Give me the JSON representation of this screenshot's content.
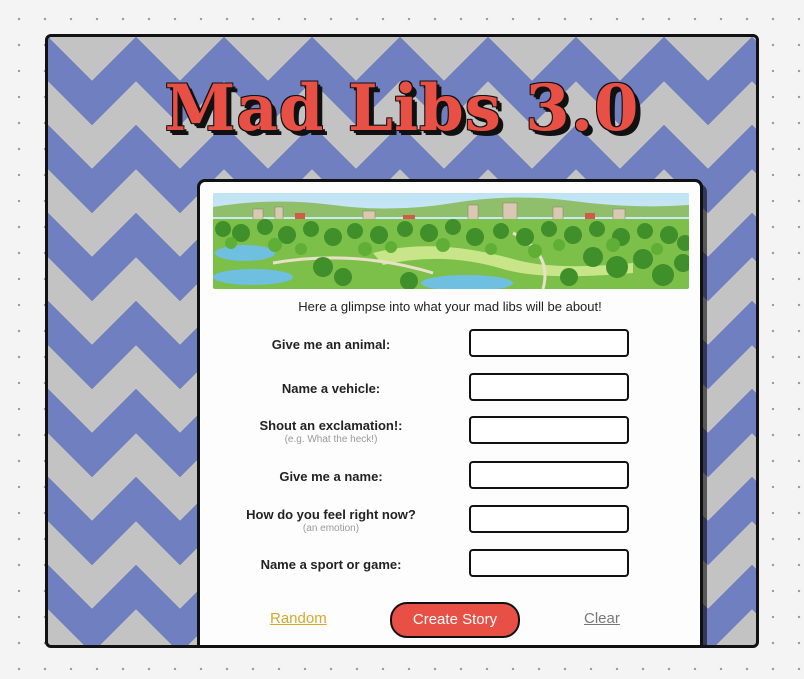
{
  "page": {
    "title": "Mad Libs 3.0",
    "glimpse_text": "Here a glimpse into what your mad libs will be about!"
  },
  "fields": [
    {
      "label": "Give me an animal:",
      "hint": "",
      "value": ""
    },
    {
      "label": "Name a vehicle:",
      "hint": "",
      "value": ""
    },
    {
      "label": "Shout an exclamation!:",
      "hint": "(e.g. What the heck!)",
      "value": ""
    },
    {
      "label": "Give me a name:",
      "hint": "",
      "value": ""
    },
    {
      "label": "How do you feel right now?",
      "hint": "(an emotion)",
      "value": ""
    },
    {
      "label": "Name a sport or game:",
      "hint": "",
      "value": ""
    }
  ],
  "actions": {
    "random_label": "Random",
    "create_label": "Create Story",
    "clear_label": "Clear"
  },
  "colors": {
    "accent": "#e84f45",
    "random_link": "#d4a92a",
    "chevron_blue": "#6f7fbf",
    "chevron_gray": "#c3c3c3"
  },
  "banner_image": "park-landscape-illustration"
}
